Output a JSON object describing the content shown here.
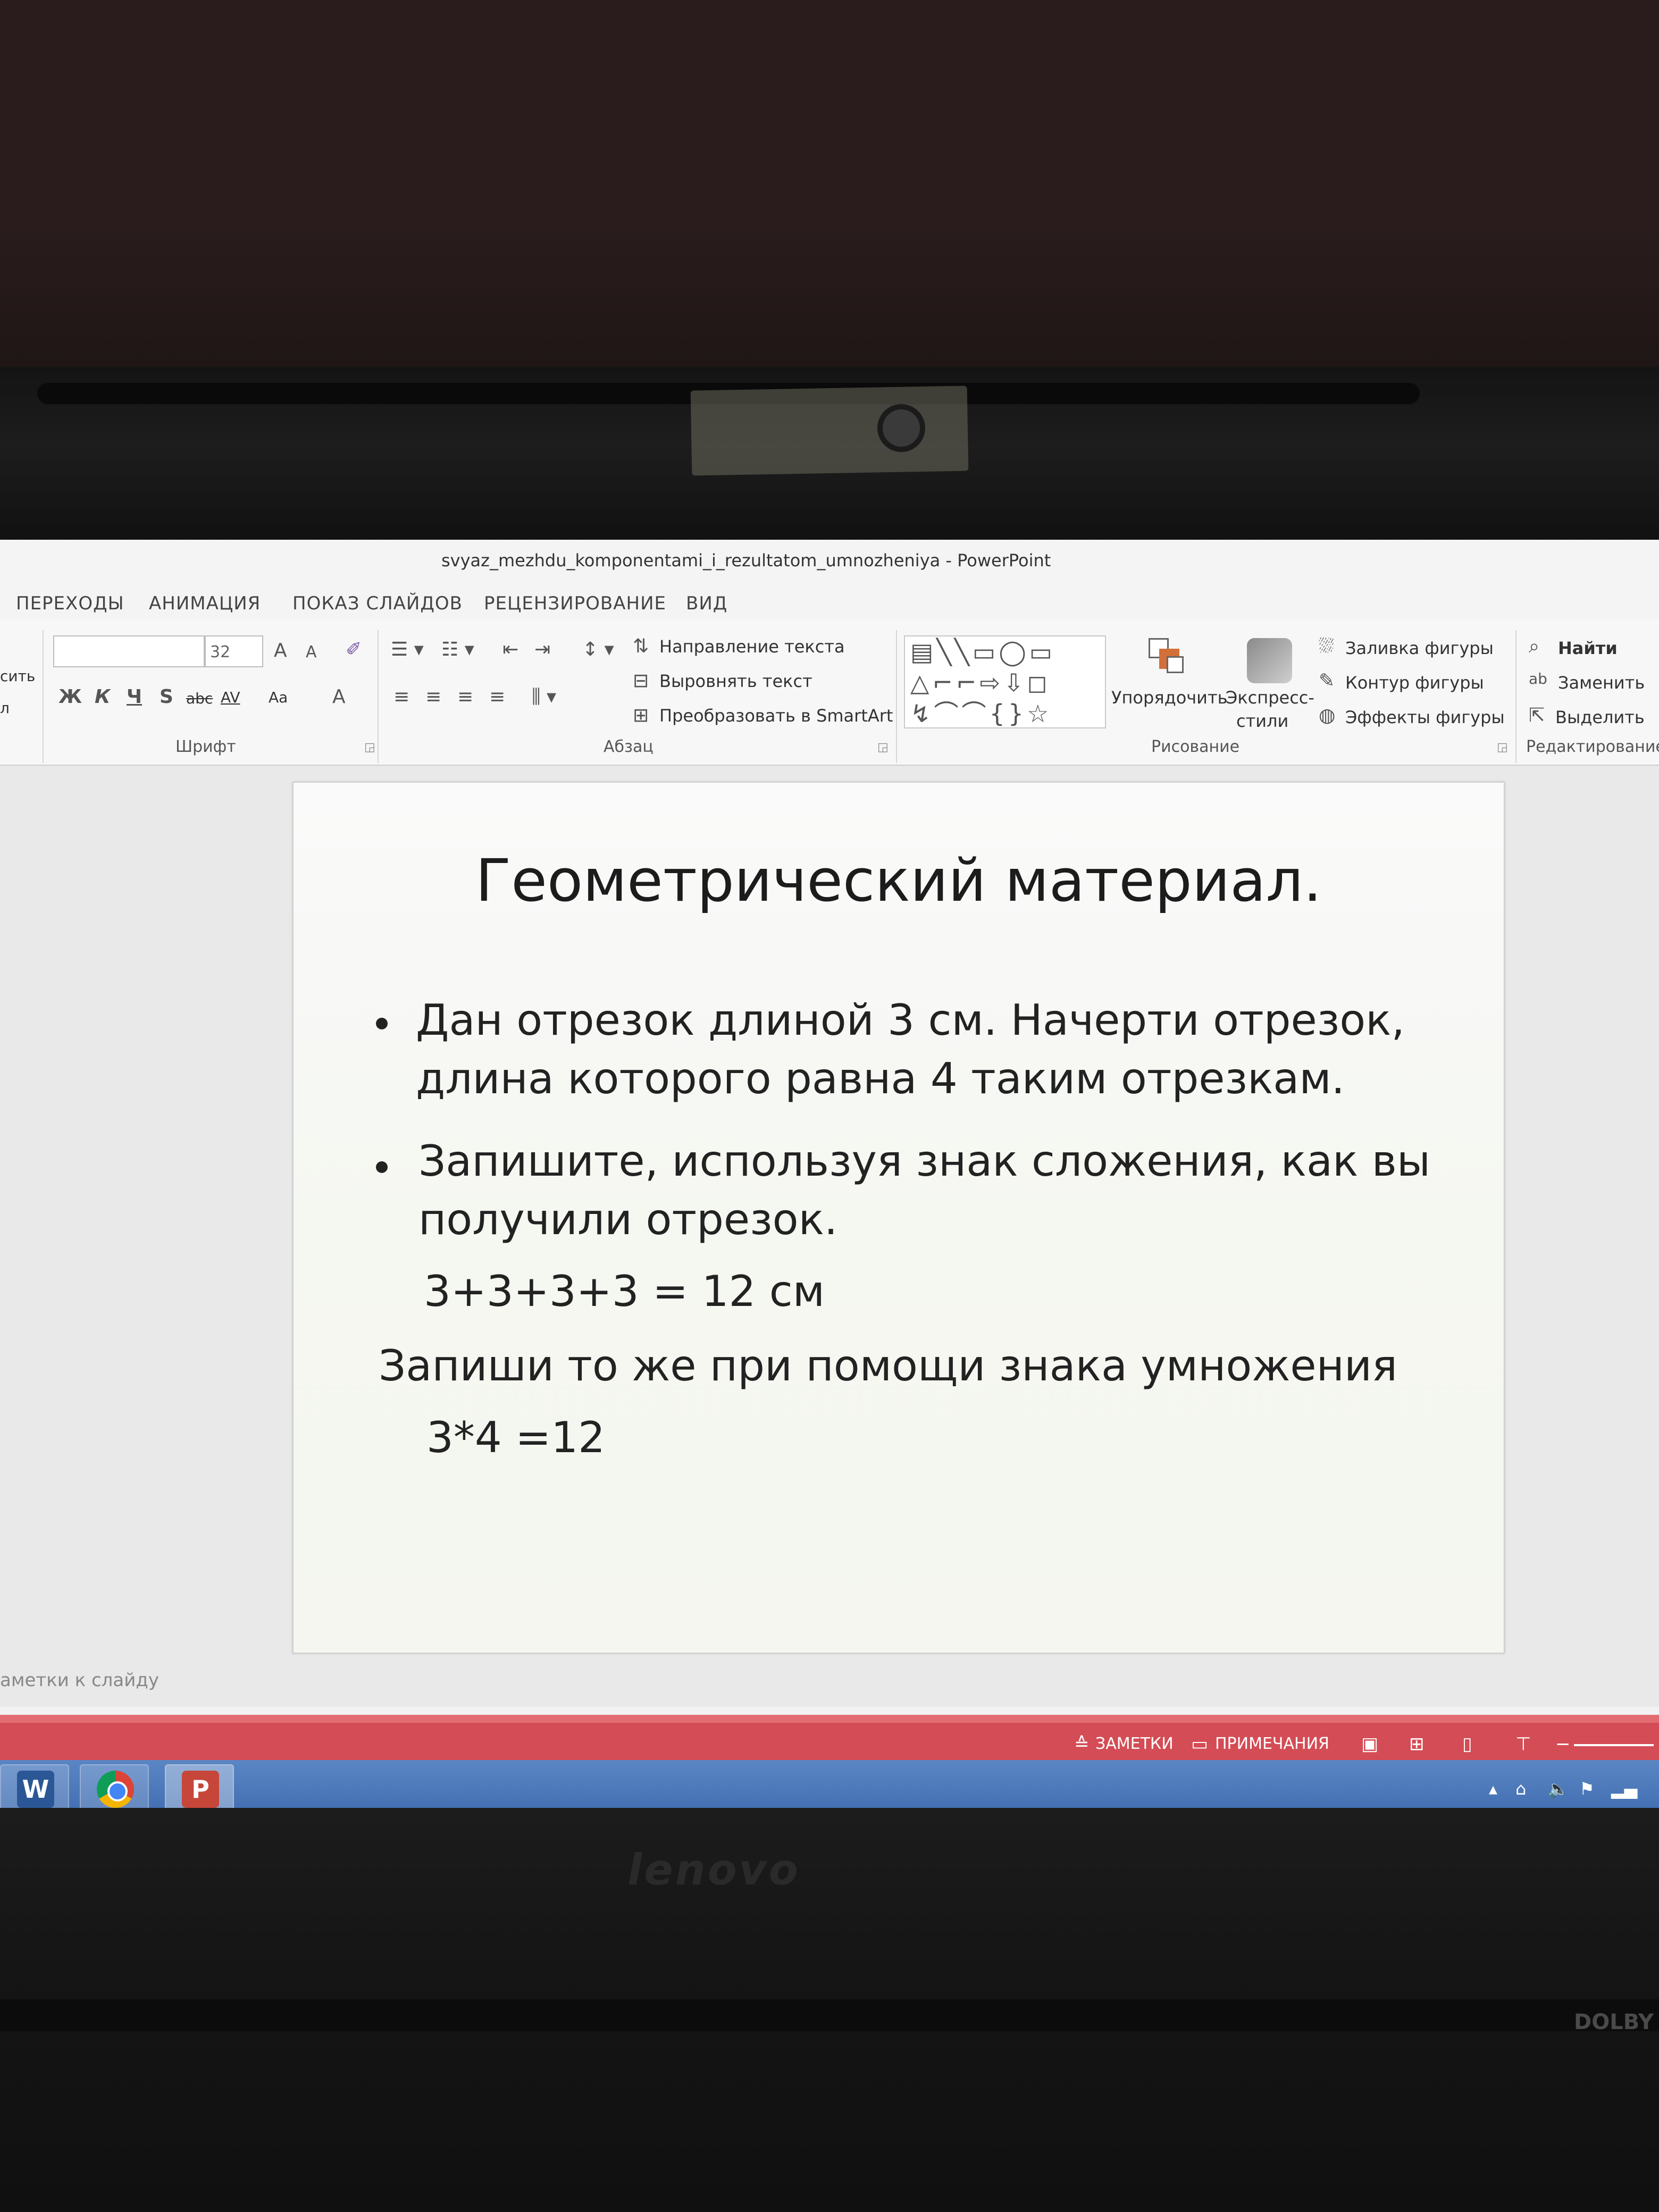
{
  "window": {
    "title": "svyaz_mezhdu_komponentami_i_rezultatom_umnozheniya - PowerPoint"
  },
  "tabs": [
    "ПЕРЕХОДЫ",
    "АНИМАЦИЯ",
    "ПОКАЗ СЛАЙДОВ",
    "РЕЦЕНЗИРОВАНИЕ",
    "ВИД"
  ],
  "ribbon": {
    "clipboard_fragments": [
      "сить",
      "л"
    ],
    "font": {
      "size_value": "32",
      "group_label": "Шрифт",
      "grow_label": "A",
      "shrink_label": "A",
      "bold": "Ж",
      "italic": "К",
      "underline": "Ч",
      "shadow": "S",
      "strike": "abc",
      "spacing": "AV",
      "case": "Aa",
      "color": "A"
    },
    "paragraph": {
      "group_label": "Абзац",
      "text_direction": "Направление текста",
      "align_text": "Выровнять текст",
      "smartart": "Преобразовать в SmartArt"
    },
    "drawing": {
      "group_label": "Рисование",
      "arrange": "Упорядочить",
      "quick_styles_1": "Экспресс-",
      "quick_styles_2": "стили",
      "shape_fill": "Заливка фигуры",
      "shape_outline": "Контур фигуры",
      "shape_effects": "Эффекты фигуры"
    },
    "editing": {
      "group_label": "Редактирование",
      "find": "Найти",
      "replace": "Заменить",
      "select": "Выделить"
    }
  },
  "slide": {
    "title": "Геометрический материал.",
    "bullet1_line1": "Дан отрезок длиной 3 см. Начерти отрезок,",
    "bullet1_line2": "длина которого равна 4 таким отрезкам.",
    "bullet2_line1": "Запишите, используя знак сложения, как вы",
    "bullet2_line2": "получили отрезок.",
    "addition": "3+3+3+3 = 12 см",
    "instruction": "Запиши то же при помощи знака умножения",
    "multiplication": "3*4 =12"
  },
  "notes_placeholder": "аметки к слайду",
  "statusbar": {
    "notes": "ЗАМЕТКИ",
    "comments": "ПРИМЕЧАНИЯ"
  },
  "taskbar": {
    "apps": [
      "word",
      "chrome",
      "powerpoint"
    ]
  },
  "laptop": {
    "brand": "lenovo",
    "audio_badge": "DOLBY"
  },
  "colors": {
    "statusbar": "#d44c55",
    "taskbar": "#3f6cb0",
    "slide_text": "#222222"
  }
}
